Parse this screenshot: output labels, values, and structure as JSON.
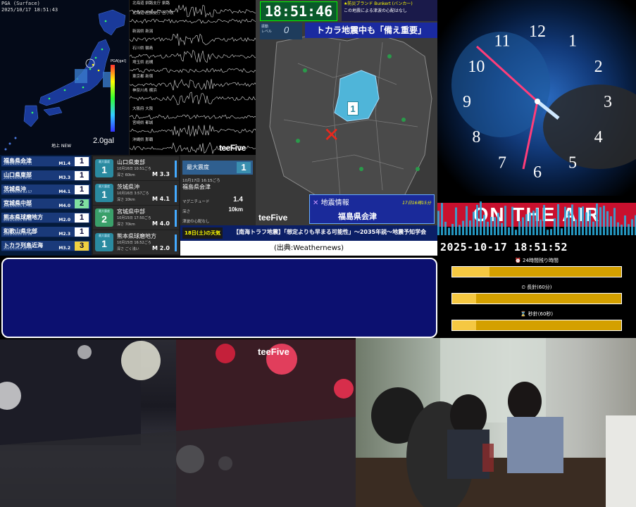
{
  "seismic": {
    "header": "PGA (Surface)",
    "timestamp": "2025/10/17 18:51:43",
    "scale_label": "PGA[gal]",
    "gal_value": "2.0gal",
    "region_tag": "地上 NEW",
    "logo": "teeFive"
  },
  "waveforms": {
    "stations": [
      "北海道 釧路支庁 釧路",
      "北海道 胆振支庁 苫小牧",
      "新潟県 新潟",
      "石川県 輪島",
      "埼玉県 岩槻",
      "東京都 新宿",
      "神奈川県 横浜",
      "大阪府 大阪",
      "宮崎県 都城",
      "沖縄県 那覇"
    ],
    "logo": "teeFive"
  },
  "quake_list": [
    {
      "name": "福島県会津",
      "date": "2025/10/17 16:15",
      "mag": "M1.4",
      "int": "1"
    },
    {
      "name": "山口県東部",
      "date": "2025/10/16 10:51",
      "mag": "M3.3",
      "int": "1"
    },
    {
      "name": "茨城県沖",
      "date": "2025/10/16 03:57",
      "mag": "M4.1",
      "int": "1"
    },
    {
      "name": "宮城県中部",
      "date": "2025/10/15 17:50",
      "mag": "M4.0",
      "int": "2"
    },
    {
      "name": "熊本県球磨地方",
      "date": "2025/10/15 16:52",
      "mag": "M2.0",
      "int": "1"
    },
    {
      "name": "和歌山県北部",
      "date": "2025/10/14 22:28",
      "mag": "M2.3",
      "int": "1"
    },
    {
      "name": "トカラ列島近海",
      "date": "2025/10/14 22:23",
      "mag": "M3.2",
      "int": "3"
    }
  ],
  "quake_cards": [
    {
      "label": "最大震度",
      "int": "1",
      "name": "山口県東部",
      "date": "10月16日 10:51ごろ",
      "depth": "深さ 60km",
      "mag": "M 3.3"
    },
    {
      "label": "最大震度",
      "int": "1",
      "name": "茨城県沖",
      "date": "10月16日 3:57ごろ",
      "depth": "深さ 10km",
      "mag": "M 4.1"
    },
    {
      "label": "最大震度",
      "int": "2",
      "name": "宮城県中部",
      "date": "10月15日 17:50ごろ",
      "depth": "深さ 70km",
      "mag": "M 4.0"
    },
    {
      "label": "最大震度",
      "int": "1",
      "name": "熊本県球磨地方",
      "date": "10月15日 16:52ごろ",
      "depth": "深さ ごく浅い",
      "mag": "M 2.0"
    }
  ],
  "max_intensity": {
    "label": "最大震度",
    "value": "1",
    "time": "10月17日 16:15ごろ",
    "place": "福島県会津",
    "mag_label": "マグニチュード",
    "mag_value": "1.4",
    "depth_label": "深さ",
    "depth_value": "10km",
    "tsunami": "津波の心配なし"
  },
  "quake_map": {
    "clock": "18:51:46",
    "shindo_label": "振動\nレベル",
    "shindo_value": "0",
    "sponsor": "★防災ブランド Bunkert (バンカー)",
    "tsunami_note": "この地震による津波の心配はなし",
    "banner": "トカラ地震中も「備え重要」",
    "info_title": "地震情報",
    "info_time": "17日16時15分",
    "info_place": "福島県会津",
    "epicenter_int": "1",
    "logo": "teeFive"
  },
  "ticker": {
    "date_label": "18日(土)の天気",
    "message": "【南海トラフ地震】「想定よりも早まる可能性」～2035年説～地震予知学会"
  },
  "source": "(出典:Weathernews)",
  "clock_panel": {
    "numbers": [
      "12",
      "1",
      "2",
      "3",
      "4",
      "5",
      "6",
      "7",
      "8",
      "9",
      "10",
      "11"
    ]
  },
  "on_air": "ON THE AIR",
  "datetime": "2025-10-17 18:51:52",
  "progress": [
    {
      "label": "24時間残り時間",
      "value": 0.22,
      "icon": "alarm-icon"
    },
    {
      "label": "長針(60分)",
      "value": 0.14,
      "icon": "clock-icon"
    },
    {
      "label": "秒針(60秒)",
      "value": 0.14,
      "icon": "hourglass-icon"
    }
  ],
  "street": {
    "logo": "teeFive"
  }
}
